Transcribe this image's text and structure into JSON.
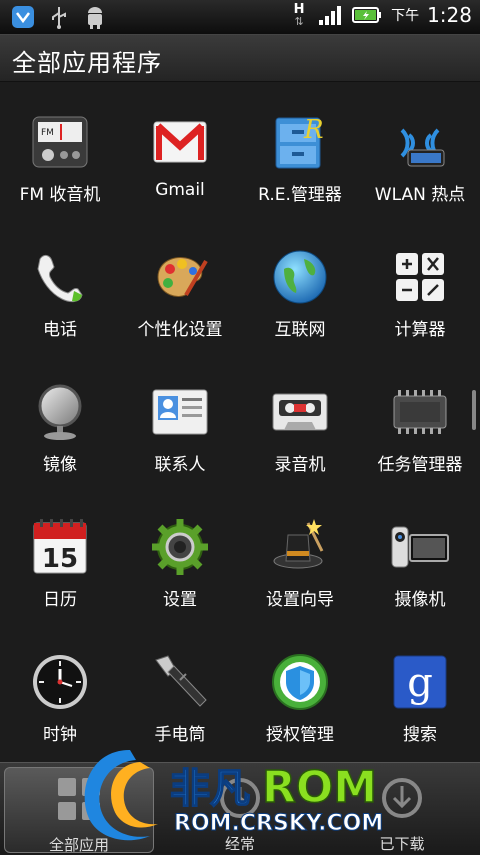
{
  "status_bar": {
    "network_type": "H",
    "ampm": "下午",
    "time": "1:28",
    "icons": [
      "shield-icon",
      "usb-icon",
      "android-debug-icon",
      "network-arrows-icon",
      "signal-icon",
      "battery-icon"
    ]
  },
  "header": {
    "title": "全部应用程序"
  },
  "apps": [
    {
      "label": "FM 收音机",
      "icon": "radio-icon"
    },
    {
      "label": "Gmail",
      "icon": "gmail-icon"
    },
    {
      "label": "R.E.管理器",
      "icon": "file-manager-icon"
    },
    {
      "label": "WLAN 热点",
      "icon": "wifi-hotspot-icon"
    },
    {
      "label": "电话",
      "icon": "phone-icon"
    },
    {
      "label": "个性化设置",
      "icon": "palette-icon"
    },
    {
      "label": "互联网",
      "icon": "globe-icon"
    },
    {
      "label": "计算器",
      "icon": "calculator-icon"
    },
    {
      "label": "镜像",
      "icon": "mirror-icon"
    },
    {
      "label": "联系人",
      "icon": "contacts-icon"
    },
    {
      "label": "录音机",
      "icon": "cassette-icon"
    },
    {
      "label": "任务管理器",
      "icon": "chip-icon"
    },
    {
      "label": "日历",
      "icon": "calendar-icon",
      "badge": "15"
    },
    {
      "label": "设置",
      "icon": "gear-icon"
    },
    {
      "label": "设置向导",
      "icon": "magic-hat-icon"
    },
    {
      "label": "摄像机",
      "icon": "camcorder-icon"
    },
    {
      "label": "时钟",
      "icon": "clock-icon"
    },
    {
      "label": "手电筒",
      "icon": "flashlight-icon"
    },
    {
      "label": "授权管理",
      "icon": "shield-check-icon"
    },
    {
      "label": "搜索",
      "icon": "google-search-icon",
      "badge": "g"
    }
  ],
  "bottom_tabs": [
    {
      "label": "全部应用",
      "icon": "all-apps-icon"
    },
    {
      "label": "经常",
      "icon": "frequent-icon"
    },
    {
      "label": "已下载",
      "icon": "downloaded-icon"
    }
  ],
  "watermark": {
    "brand_cn": "非凡",
    "brand_en": "ROM",
    "url": "ROM.CRSKY.COM"
  }
}
